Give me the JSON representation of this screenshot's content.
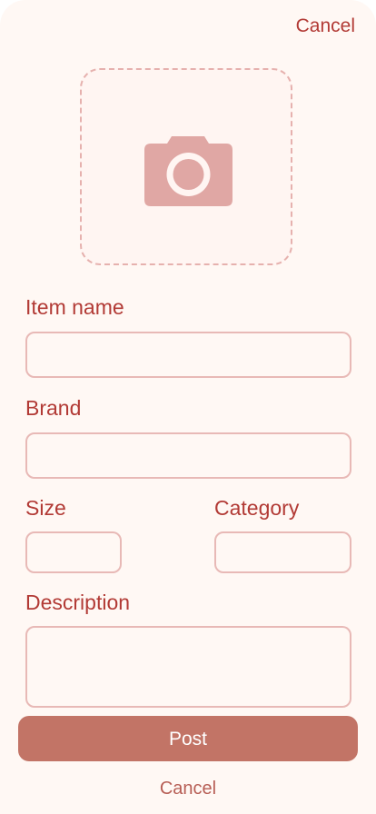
{
  "header": {
    "cancel_label": "Cancel"
  },
  "photo": {
    "icon": "camera-icon"
  },
  "form": {
    "item_name_label": "Item name",
    "item_name_value": "",
    "brand_label": "Brand",
    "brand_value": "",
    "size_label": "Size",
    "size_value": "",
    "category_label": "Category",
    "category_value": "",
    "description_label": "Description",
    "description_value": ""
  },
  "actions": {
    "post_label": "Post",
    "cancel_label": "Cancel"
  },
  "colors": {
    "accent": "#b23a35",
    "post_button": "#c27466",
    "background": "#fff8f4",
    "field_border": "#e8b9b6",
    "camera_icon": "#e0a7a4"
  }
}
